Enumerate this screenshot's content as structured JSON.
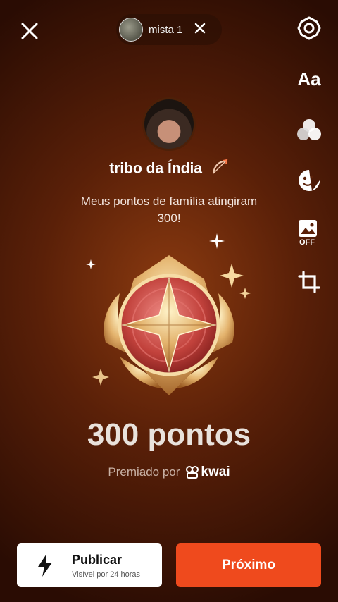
{
  "top_bar": {
    "recipient_name": "mista 1",
    "close_icon": "close-icon",
    "remove_recipient_icon": "close-icon"
  },
  "tools": [
    {
      "name": "settings",
      "icon": "gear-icon"
    },
    {
      "name": "text",
      "label": "Aa"
    },
    {
      "name": "filters",
      "icon": "filters-icon"
    },
    {
      "name": "sticker",
      "icon": "sticker-icon"
    },
    {
      "name": "gallery",
      "icon": "image-off-icon",
      "badge": "OFF"
    },
    {
      "name": "crop",
      "icon": "crop-icon"
    }
  ],
  "card": {
    "username": "tribo da Índia",
    "message": "Meus pontos de família atingiram 300!",
    "points": "300 pontos",
    "awarded_by": "Premiado por",
    "brand": "kwai"
  },
  "actions": {
    "publish_label": "Publicar",
    "publish_sub": "Visível por 24 horas",
    "next_label": "Próximo"
  },
  "colors": {
    "accent": "#ef4a1d",
    "background": "#5a2008"
  }
}
